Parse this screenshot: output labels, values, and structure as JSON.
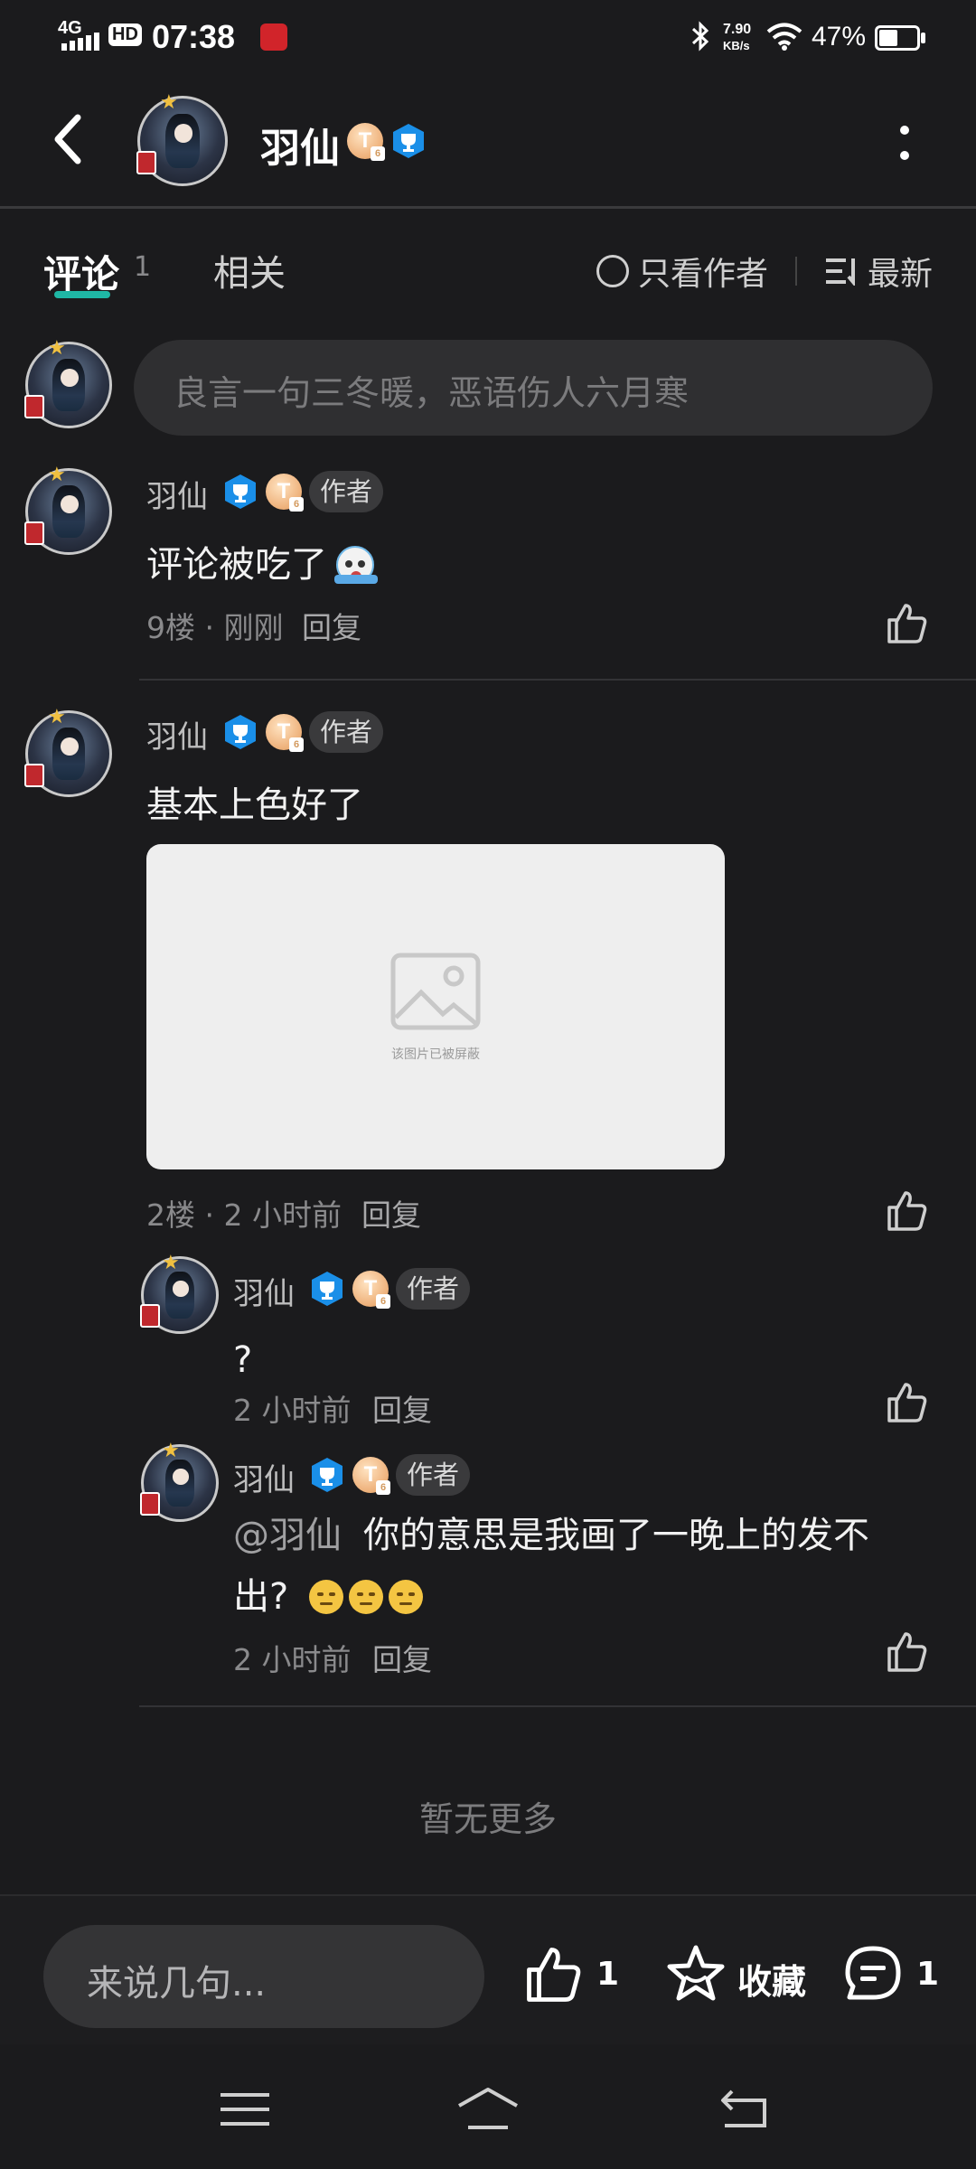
{
  "status_bar": {
    "network": "4G",
    "hd": "HD",
    "time": "07:38",
    "speed_value": "7.90",
    "speed_unit": "KB/s",
    "battery": "47%"
  },
  "header": {
    "title": "羽仙"
  },
  "tabs": {
    "comments_label": "评论",
    "comments_count": "1",
    "related_label": "相关",
    "author_only_label": "只看作者",
    "sort_label": "最新"
  },
  "comment_input": {
    "placeholder": "良言一句三冬暖，恶语伤人六月寒"
  },
  "comments": [
    {
      "username": "羽仙",
      "author_tag": "作者",
      "text": "评论被吃了",
      "meta": "9楼 · 刚刚",
      "reply_label": "回复"
    },
    {
      "username": "羽仙",
      "author_tag": "作者",
      "text": "基本上色好了",
      "image_blocked_text": "该图片已被屏蔽",
      "meta": "2楼 · 2 小时前",
      "reply_label": "回复",
      "replies": [
        {
          "username": "羽仙",
          "author_tag": "作者",
          "text": "?",
          "meta": "2 小时前",
          "reply_label": "回复"
        },
        {
          "username": "羽仙",
          "author_tag": "作者",
          "mention": "@羽仙",
          "text_line1": "你的意思是我画了一晚上的发不",
          "text_line2": "出?",
          "meta": "2 小时前",
          "reply_label": "回复"
        }
      ]
    }
  ],
  "no_more": "暂无更多",
  "bottom_bar": {
    "input_placeholder": "来说几句...",
    "like_count": "1",
    "favorite_label": "收藏",
    "comment_count": "1"
  },
  "colors": {
    "background": "#1b1b1d",
    "accent_teal": "#1fb7a5",
    "trophy_blue": "#1a8fe8"
  }
}
